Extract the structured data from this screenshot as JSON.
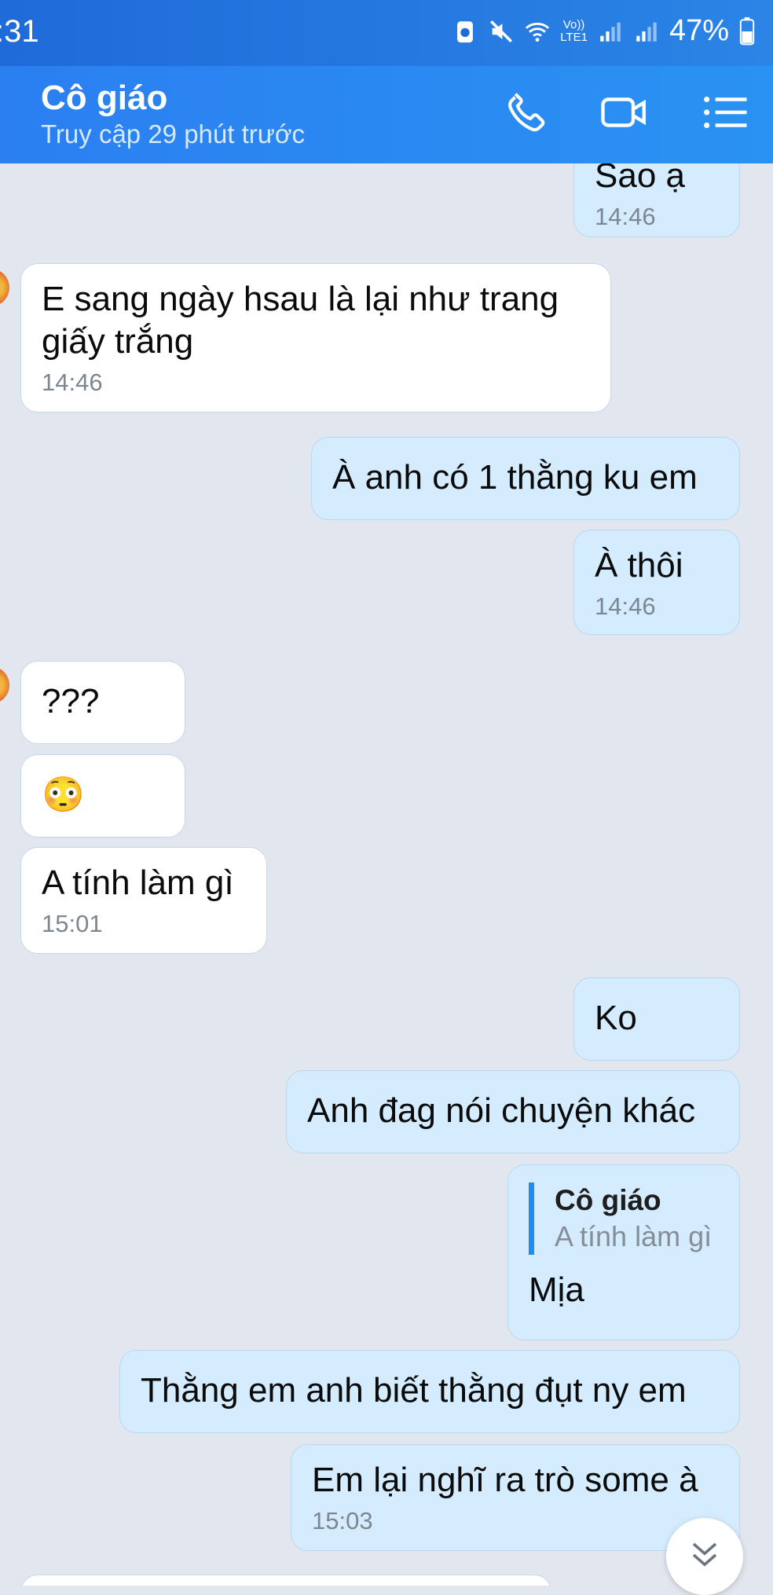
{
  "status_bar": {
    "time": ":31",
    "network_label_top": "Vo))",
    "network_label_bottom": "LTE1",
    "battery": "47%"
  },
  "header": {
    "title": "Cô giáo",
    "subtitle": "Truy cập 29 phút trước"
  },
  "messages": [
    {
      "dir": "out",
      "text": "Sao ạ",
      "time": "14:46"
    },
    {
      "dir": "in",
      "text": "E sang ngày hsau là lại như trang giấy trắng",
      "time": "14:46"
    },
    {
      "dir": "out",
      "text": "À anh có 1 thằng ku em"
    },
    {
      "dir": "out",
      "text": "À thôi",
      "time": "14:46"
    },
    {
      "dir": "in",
      "text": "???"
    },
    {
      "dir": "in",
      "emoji": "😳"
    },
    {
      "dir": "in",
      "text": "A tính làm gì",
      "time": "15:01"
    },
    {
      "dir": "out",
      "text": "Ko"
    },
    {
      "dir": "out",
      "text": "Anh đag nói chuyện khác"
    },
    {
      "dir": "out",
      "quote": {
        "name": "Cô giáo",
        "text": "A tính làm gì"
      },
      "text": "Mịa"
    },
    {
      "dir": "out",
      "text": "Thằng em anh biết thằng đụt ny em"
    },
    {
      "dir": "out",
      "text": "Em lại nghĩ ra trò some à",
      "time": "15:03"
    }
  ],
  "icons": {
    "call": "phone-icon",
    "video": "video-camera-icon",
    "menu": "list-menu-icon",
    "scroll": "double-chevron-down-icon"
  }
}
